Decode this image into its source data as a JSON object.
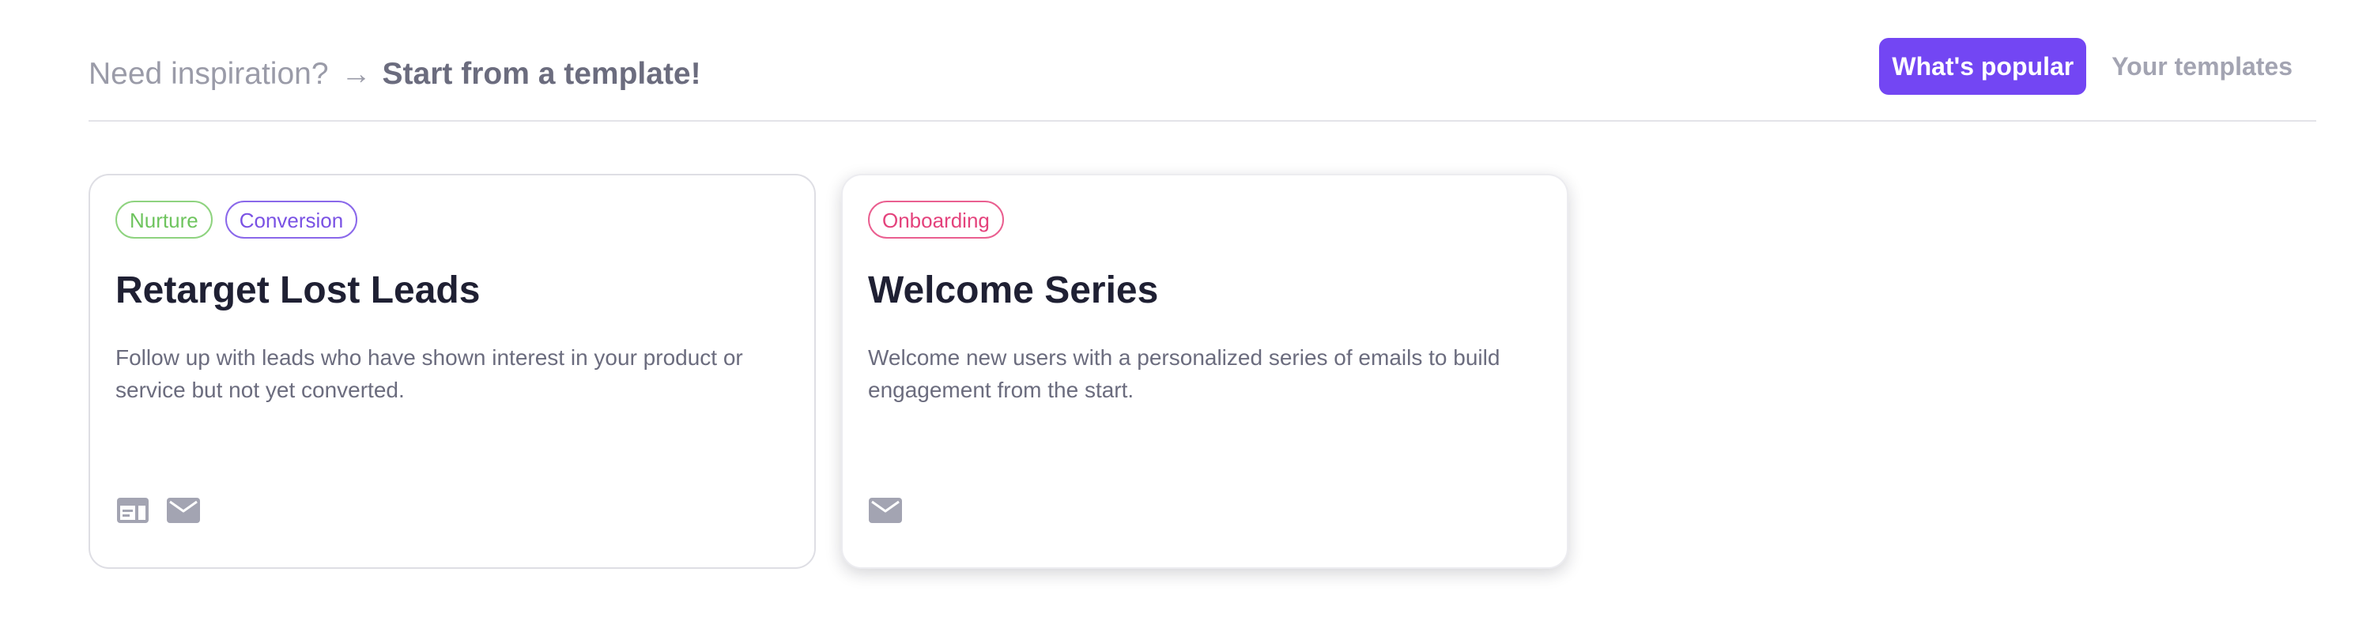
{
  "header": {
    "prefix": "Need inspiration?",
    "arrow": "→",
    "call_to_action": "Start from a template!"
  },
  "tabs": [
    {
      "label": "What's popular",
      "active": true
    },
    {
      "label": "Your templates",
      "active": false
    }
  ],
  "templates": [
    {
      "tags": [
        "Nurture",
        "Conversion"
      ],
      "title": "Retarget Lost Leads",
      "description": "Follow up with leads who have shown interest in your product or service but not yet converted.",
      "channels": [
        "layout-icon",
        "mail-icon"
      ]
    },
    {
      "tags": [
        "Onboarding"
      ],
      "title": "Welcome Series",
      "description": "Welcome new users with a personalized series of emails to build engagement from the start.",
      "channels": [
        "mail-icon"
      ]
    }
  ],
  "colors": {
    "accent": "#7346f3",
    "tag_nurture": "#6ec45e",
    "tag_conversion": "#7a52e4",
    "tag_onboarding": "#e4427c",
    "icon": "#a3a4b2"
  }
}
